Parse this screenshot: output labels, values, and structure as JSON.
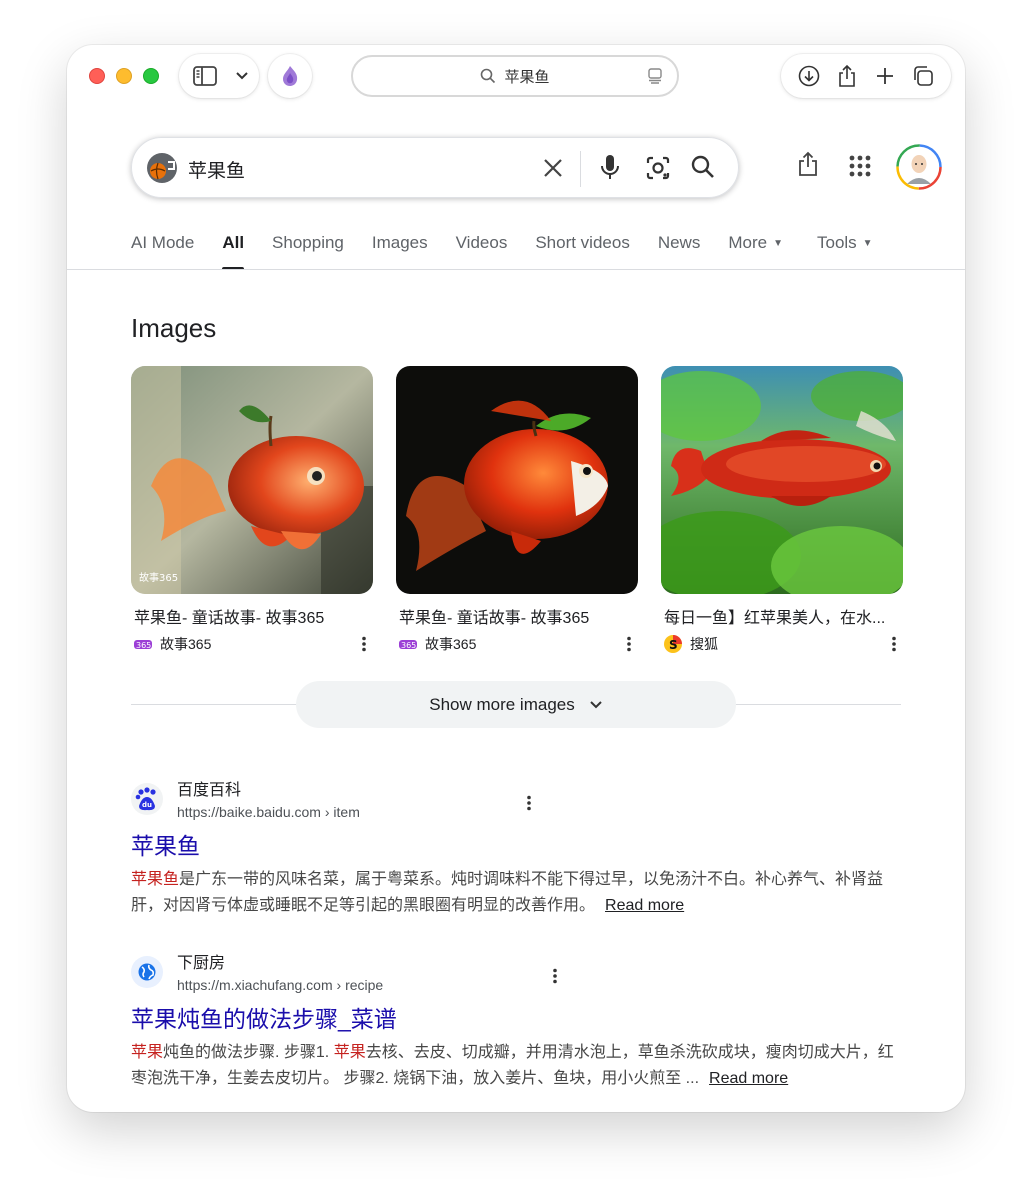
{
  "browser": {
    "address": "苹果鱼"
  },
  "search": {
    "query": "苹果鱼"
  },
  "tabs": [
    {
      "label": "AI Mode"
    },
    {
      "label": "All"
    },
    {
      "label": "Shopping"
    },
    {
      "label": "Images"
    },
    {
      "label": "Videos"
    },
    {
      "label": "Short videos"
    },
    {
      "label": "News"
    },
    {
      "label": "More"
    },
    {
      "label": "Tools"
    }
  ],
  "images_section": {
    "heading": "Images",
    "cards": [
      {
        "title": "苹果鱼- 童话故事- 故事365",
        "source": "故事365"
      },
      {
        "title": "苹果鱼- 童话故事- 故事365",
        "source": "故事365"
      },
      {
        "title": "每日一鱼】红苹果美人，在水...",
        "source": "搜狐"
      }
    ],
    "show_more": "Show more images"
  },
  "results": [
    {
      "site": "百度百科",
      "url": "https://baike.baidu.com › item",
      "title": "苹果鱼",
      "snippet_hl": "苹果鱼",
      "snippet": "是广东一带的风味名菜，属于粤菜系。炖时调味料不能下得过早，以免汤汁不白。补心养气、补肾益肝，对因肾亏体虚或睡眠不足等引起的黑眼圈有明显的改善作用。",
      "read_more": "Read more"
    },
    {
      "site": "下厨房",
      "url": "https://m.xiachufang.com › recipe",
      "title": "苹果炖鱼的做法步骤_菜谱",
      "snippet_hl": "苹果",
      "snippet_a": "炖鱼的做法步骤. 步骤1. ",
      "snippet_hl2": "苹果",
      "snippet_b": "去核、去皮、切成瓣，并用清水泡上，草鱼杀洗砍成块，瘦肉切成大片，红枣泡洗干净，生姜去皮切片。 步骤2. 烧锅下油，放入姜片、鱼块，用小火煎至 ...",
      "read_more": "Read more"
    }
  ],
  "colors": {
    "link": "#1a0dab",
    "highlight": "#c5221f",
    "traffic_red": "#ff5f57",
    "traffic_yellow": "#febc2e",
    "traffic_green": "#28c840"
  }
}
